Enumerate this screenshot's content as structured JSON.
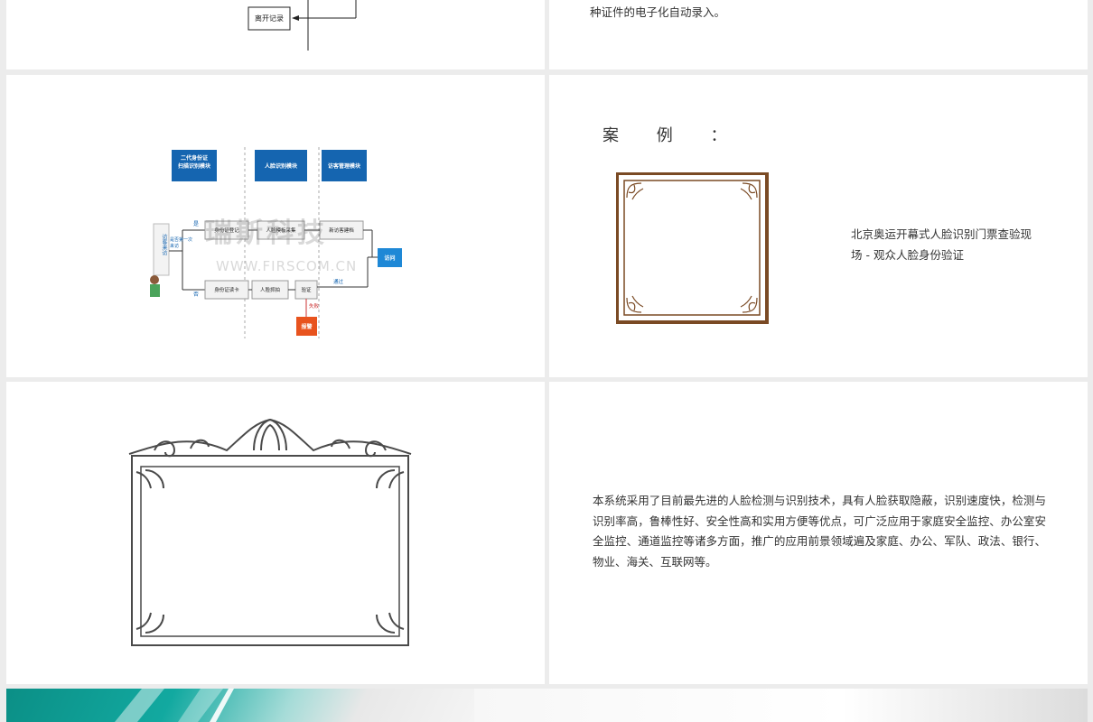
{
  "slide_top_left": {
    "flow_box_label": "离开记录"
  },
  "slide_top_right": {
    "text": "种证件的电子化自动录入。"
  },
  "flowchart": {
    "module_id": "二代身份证\n扫描识别模块",
    "module_face": "人脸识别模块",
    "module_visitor": "访客管理模块",
    "visitor_label": "访客来访",
    "decision_label": "是否第一次来访",
    "yes_label": "是",
    "no_label": "否",
    "id_register": "身份证登记",
    "face_capture": "人脸模板采集",
    "new_visitor": "新访客建档",
    "id_read": "身份证读卡",
    "face_compare": "人脸抓拍",
    "verify": "验证",
    "pass_label": "通过",
    "fail_label": "失败",
    "alarm": "报警",
    "visit": "访问",
    "watermark_cn": "瑞斯科技",
    "watermark_url": "WWW.FIRSCOM.CN"
  },
  "case_slide": {
    "title": "案 例 ：",
    "caption": "北京奥运开幕式人脸识别门票查验现场 - 观众人脸身份验证"
  },
  "summary_slide": {
    "text": "本系统采用了目前最先进的人脸检测与识别技术，具有人脸获取隐蔽，识别速度快，检测与识别率高，鲁棒性好、安全性高和实用方便等优点，可广泛应用于家庭安全监控、办公室安全监控、通道监控等诸多方面，推广的应用前景领域遍及家庭、办公、军队、政法、银行、物业、海关、互联网等。"
  },
  "colors": {
    "frame_brown": "#7a4a24",
    "frame_gray": "#4a4a4a",
    "module_blue": "#1565b0",
    "alarm_red": "#e8531e",
    "teal": "#12a9a0"
  }
}
